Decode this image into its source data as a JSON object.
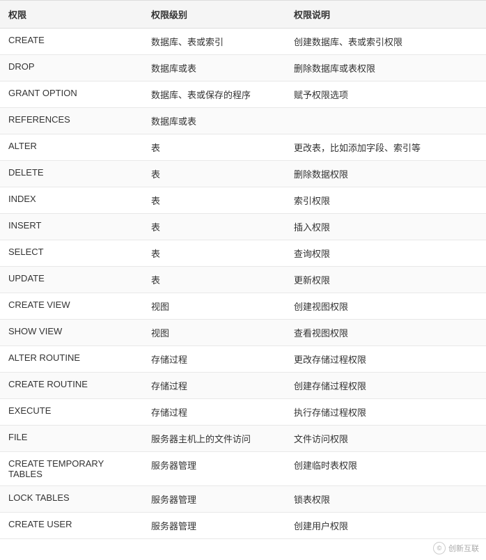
{
  "table": {
    "headers": [
      "权限",
      "权限级别",
      "权限说明"
    ],
    "rows": [
      {
        "priv": "CREATE",
        "level": "数据库、表或索引",
        "desc": "创建数据库、表或索引权限"
      },
      {
        "priv": "DROP",
        "level": "数据库或表",
        "desc": "删除数据库或表权限"
      },
      {
        "priv": "GRANT OPTION",
        "level": "数据库、表或保存的程序",
        "desc": "赋予权限选项"
      },
      {
        "priv": "REFERENCES",
        "level": "数据库或表",
        "desc": ""
      },
      {
        "priv": "ALTER",
        "level": "表",
        "desc": "更改表，比如添加字段、索引等"
      },
      {
        "priv": "DELETE",
        "level": "表",
        "desc": "删除数据权限"
      },
      {
        "priv": "INDEX",
        "level": "表",
        "desc": "索引权限"
      },
      {
        "priv": "INSERT",
        "level": "表",
        "desc": "插入权限"
      },
      {
        "priv": "SELECT",
        "level": "表",
        "desc": "查询权限"
      },
      {
        "priv": "UPDATE",
        "level": "表",
        "desc": "更新权限"
      },
      {
        "priv": "CREATE VIEW",
        "level": "视图",
        "desc": "创建视图权限"
      },
      {
        "priv": "SHOW VIEW",
        "level": "视图",
        "desc": "查看视图权限"
      },
      {
        "priv": "ALTER ROUTINE",
        "level": "存储过程",
        "desc": "更改存储过程权限"
      },
      {
        "priv": "CREATE ROUTINE",
        "level": "存储过程",
        "desc": "创建存储过程权限"
      },
      {
        "priv": "EXECUTE",
        "level": "存储过程",
        "desc": "执行存储过程权限"
      },
      {
        "priv": "FILE",
        "level": "服务器主机上的文件访问",
        "desc": "文件访问权限"
      },
      {
        "priv": "CREATE TEMPORARY TABLES",
        "level": "服务器管理",
        "desc": "创建临时表权限"
      },
      {
        "priv": "LOCK TABLES",
        "level": "服务器管理",
        "desc": "锁表权限"
      },
      {
        "priv": "CREATE USER",
        "level": "服务器管理",
        "desc": "创建用户权限"
      }
    ]
  },
  "watermark": {
    "icon": "©",
    "text": "创新互联"
  }
}
